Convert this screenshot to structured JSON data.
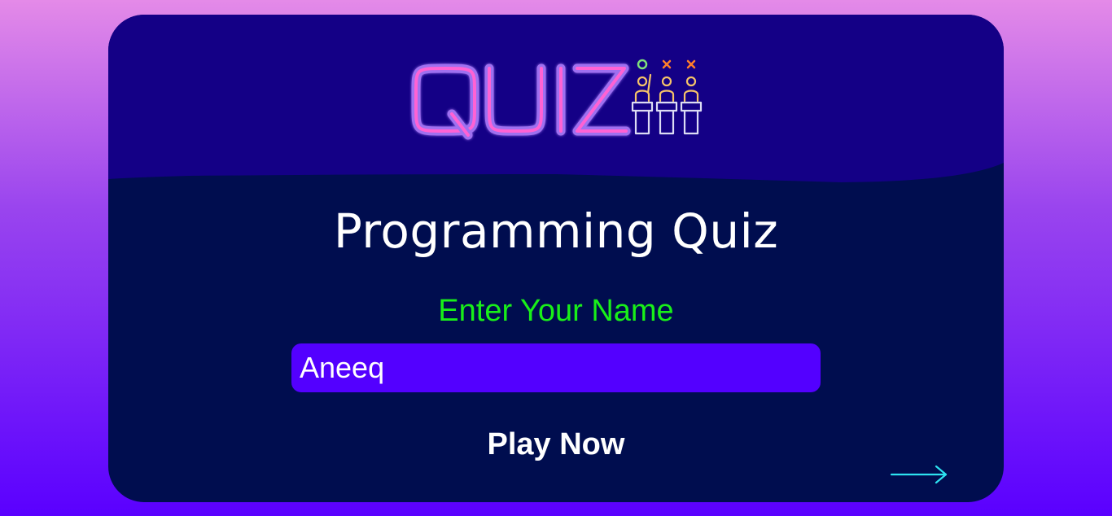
{
  "logo": {
    "text": "QUIZ",
    "icon": "quiz-podium-contestants-icon"
  },
  "main": {
    "title": "Programming Quiz",
    "name_label": "Enter Your Name",
    "name_input_value": "Aneeq",
    "play_button_label": "Play Now",
    "next_arrow_icon": "arrow-right-icon"
  },
  "colors": {
    "page_gradient_top": "#e48ae8",
    "page_gradient_bottom": "#5a00ff",
    "card_background": "#000d4f",
    "card_header_background": "#140086",
    "label_color": "#19ef19",
    "input_background": "#5300ff",
    "arrow_color": "#2de2f0",
    "logo_neon": "#ff62d4"
  }
}
